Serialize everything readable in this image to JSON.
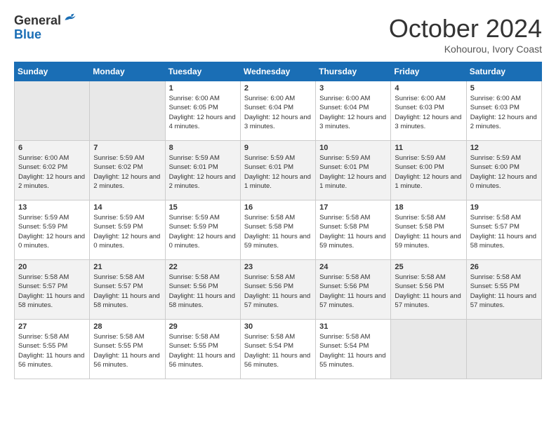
{
  "header": {
    "logo_general": "General",
    "logo_blue": "Blue",
    "month_title": "October 2024",
    "location": "Kohourou, Ivory Coast"
  },
  "days_of_week": [
    "Sunday",
    "Monday",
    "Tuesday",
    "Wednesday",
    "Thursday",
    "Friday",
    "Saturday"
  ],
  "weeks": [
    [
      {
        "day": "",
        "empty": true
      },
      {
        "day": "",
        "empty": true
      },
      {
        "day": "1",
        "sunrise": "Sunrise: 6:00 AM",
        "sunset": "Sunset: 6:05 PM",
        "daylight": "Daylight: 12 hours and 4 minutes."
      },
      {
        "day": "2",
        "sunrise": "Sunrise: 6:00 AM",
        "sunset": "Sunset: 6:04 PM",
        "daylight": "Daylight: 12 hours and 3 minutes."
      },
      {
        "day": "3",
        "sunrise": "Sunrise: 6:00 AM",
        "sunset": "Sunset: 6:04 PM",
        "daylight": "Daylight: 12 hours and 3 minutes."
      },
      {
        "day": "4",
        "sunrise": "Sunrise: 6:00 AM",
        "sunset": "Sunset: 6:03 PM",
        "daylight": "Daylight: 12 hours and 3 minutes."
      },
      {
        "day": "5",
        "sunrise": "Sunrise: 6:00 AM",
        "sunset": "Sunset: 6:03 PM",
        "daylight": "Daylight: 12 hours and 2 minutes."
      }
    ],
    [
      {
        "day": "6",
        "sunrise": "Sunrise: 6:00 AM",
        "sunset": "Sunset: 6:02 PM",
        "daylight": "Daylight: 12 hours and 2 minutes."
      },
      {
        "day": "7",
        "sunrise": "Sunrise: 5:59 AM",
        "sunset": "Sunset: 6:02 PM",
        "daylight": "Daylight: 12 hours and 2 minutes."
      },
      {
        "day": "8",
        "sunrise": "Sunrise: 5:59 AM",
        "sunset": "Sunset: 6:01 PM",
        "daylight": "Daylight: 12 hours and 2 minutes."
      },
      {
        "day": "9",
        "sunrise": "Sunrise: 5:59 AM",
        "sunset": "Sunset: 6:01 PM",
        "daylight": "Daylight: 12 hours and 1 minute."
      },
      {
        "day": "10",
        "sunrise": "Sunrise: 5:59 AM",
        "sunset": "Sunset: 6:01 PM",
        "daylight": "Daylight: 12 hours and 1 minute."
      },
      {
        "day": "11",
        "sunrise": "Sunrise: 5:59 AM",
        "sunset": "Sunset: 6:00 PM",
        "daylight": "Daylight: 12 hours and 1 minute."
      },
      {
        "day": "12",
        "sunrise": "Sunrise: 5:59 AM",
        "sunset": "Sunset: 6:00 PM",
        "daylight": "Daylight: 12 hours and 0 minutes."
      }
    ],
    [
      {
        "day": "13",
        "sunrise": "Sunrise: 5:59 AM",
        "sunset": "Sunset: 5:59 PM",
        "daylight": "Daylight: 12 hours and 0 minutes."
      },
      {
        "day": "14",
        "sunrise": "Sunrise: 5:59 AM",
        "sunset": "Sunset: 5:59 PM",
        "daylight": "Daylight: 12 hours and 0 minutes."
      },
      {
        "day": "15",
        "sunrise": "Sunrise: 5:59 AM",
        "sunset": "Sunset: 5:59 PM",
        "daylight": "Daylight: 12 hours and 0 minutes."
      },
      {
        "day": "16",
        "sunrise": "Sunrise: 5:58 AM",
        "sunset": "Sunset: 5:58 PM",
        "daylight": "Daylight: 11 hours and 59 minutes."
      },
      {
        "day": "17",
        "sunrise": "Sunrise: 5:58 AM",
        "sunset": "Sunset: 5:58 PM",
        "daylight": "Daylight: 11 hours and 59 minutes."
      },
      {
        "day": "18",
        "sunrise": "Sunrise: 5:58 AM",
        "sunset": "Sunset: 5:58 PM",
        "daylight": "Daylight: 11 hours and 59 minutes."
      },
      {
        "day": "19",
        "sunrise": "Sunrise: 5:58 AM",
        "sunset": "Sunset: 5:57 PM",
        "daylight": "Daylight: 11 hours and 58 minutes."
      }
    ],
    [
      {
        "day": "20",
        "sunrise": "Sunrise: 5:58 AM",
        "sunset": "Sunset: 5:57 PM",
        "daylight": "Daylight: 11 hours and 58 minutes."
      },
      {
        "day": "21",
        "sunrise": "Sunrise: 5:58 AM",
        "sunset": "Sunset: 5:57 PM",
        "daylight": "Daylight: 11 hours and 58 minutes."
      },
      {
        "day": "22",
        "sunrise": "Sunrise: 5:58 AM",
        "sunset": "Sunset: 5:56 PM",
        "daylight": "Daylight: 11 hours and 58 minutes."
      },
      {
        "day": "23",
        "sunrise": "Sunrise: 5:58 AM",
        "sunset": "Sunset: 5:56 PM",
        "daylight": "Daylight: 11 hours and 57 minutes."
      },
      {
        "day": "24",
        "sunrise": "Sunrise: 5:58 AM",
        "sunset": "Sunset: 5:56 PM",
        "daylight": "Daylight: 11 hours and 57 minutes."
      },
      {
        "day": "25",
        "sunrise": "Sunrise: 5:58 AM",
        "sunset": "Sunset: 5:56 PM",
        "daylight": "Daylight: 11 hours and 57 minutes."
      },
      {
        "day": "26",
        "sunrise": "Sunrise: 5:58 AM",
        "sunset": "Sunset: 5:55 PM",
        "daylight": "Daylight: 11 hours and 57 minutes."
      }
    ],
    [
      {
        "day": "27",
        "sunrise": "Sunrise: 5:58 AM",
        "sunset": "Sunset: 5:55 PM",
        "daylight": "Daylight: 11 hours and 56 minutes."
      },
      {
        "day": "28",
        "sunrise": "Sunrise: 5:58 AM",
        "sunset": "Sunset: 5:55 PM",
        "daylight": "Daylight: 11 hours and 56 minutes."
      },
      {
        "day": "29",
        "sunrise": "Sunrise: 5:58 AM",
        "sunset": "Sunset: 5:55 PM",
        "daylight": "Daylight: 11 hours and 56 minutes."
      },
      {
        "day": "30",
        "sunrise": "Sunrise: 5:58 AM",
        "sunset": "Sunset: 5:54 PM",
        "daylight": "Daylight: 11 hours and 56 minutes."
      },
      {
        "day": "31",
        "sunrise": "Sunrise: 5:58 AM",
        "sunset": "Sunset: 5:54 PM",
        "daylight": "Daylight: 11 hours and 55 minutes."
      },
      {
        "day": "",
        "empty": true
      },
      {
        "day": "",
        "empty": true
      }
    ]
  ]
}
